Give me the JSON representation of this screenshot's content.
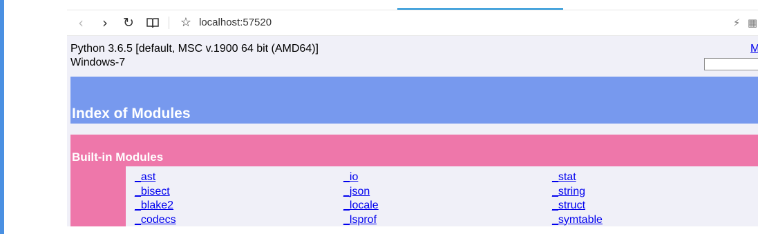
{
  "browser": {
    "address": "localhost:57520",
    "icons": {
      "back": "back-arrow-icon",
      "forward": "forward-arrow-icon",
      "refresh": "refresh-icon",
      "reader": "reading-view-icon",
      "favorite": "star-icon",
      "extension1": "bolt-icon",
      "extension2": "grid-icon"
    }
  },
  "page": {
    "python_info": "Python 3.6.5 [default, MSC v.1900 64 bit (AMD64)]",
    "os_info": "Windows-7",
    "top_link": "M",
    "search_value": "",
    "index_title": "Index of Modules",
    "builtin_section": {
      "title": "Built-in Modules",
      "columns": [
        [
          "_ast",
          "_bisect",
          "_blake2",
          "_codecs"
        ],
        [
          "_io",
          "_json",
          "_locale",
          "_lsprof"
        ],
        [
          "_stat",
          "_string",
          "_struct",
          "_symtable"
        ]
      ]
    }
  },
  "colors": {
    "heading_band": "#7799ee",
    "section_band": "#ee77aa",
    "page_background": "#f0f0f8",
    "link": "#0000ee",
    "loading_bar": "#1a8fd6"
  }
}
